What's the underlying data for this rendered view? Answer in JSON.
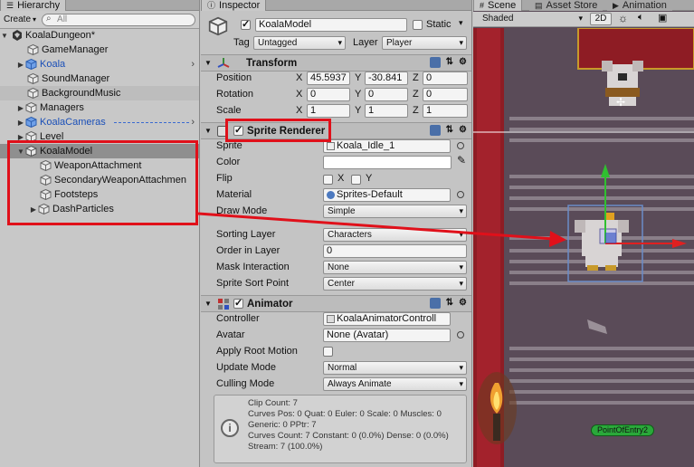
{
  "hierarchy": {
    "tab_label": "Hierarchy",
    "create_label": "Create",
    "search_placeholder": "All",
    "scene_name": "KoalaDungeon*",
    "items": [
      {
        "label": "GameManager"
      },
      {
        "label": "Koala"
      },
      {
        "label": "SoundManager"
      },
      {
        "label": "BackgroundMusic"
      },
      {
        "label": "Managers"
      },
      {
        "label": "KoalaCameras"
      },
      {
        "label": "Level"
      },
      {
        "label": "KoalaModel"
      },
      {
        "label": "WeaponAttachment"
      },
      {
        "label": "SecondaryWeaponAttachmen"
      },
      {
        "label": "Footsteps"
      },
      {
        "label": "DashParticles"
      }
    ]
  },
  "inspector": {
    "tab_label": "Inspector",
    "object_name": "KoalaModel",
    "static_label": "Static",
    "tag_label": "Tag",
    "tag_value": "Untagged",
    "layer_label": "Layer",
    "layer_value": "Player",
    "transform": {
      "title": "Transform",
      "position_label": "Position",
      "rotation_label": "Rotation",
      "scale_label": "Scale",
      "axis_x": "X",
      "axis_y": "Y",
      "axis_z": "Z",
      "position": [
        "45.5937",
        "-30.841",
        "0"
      ],
      "rotation": [
        "0",
        "0",
        "0"
      ],
      "scale": [
        "1",
        "1",
        "1"
      ]
    },
    "sprite_renderer": {
      "title": "Sprite Renderer",
      "sprite_label": "Sprite",
      "sprite_value": "Koala_Idle_1",
      "color_label": "Color",
      "flip_label": "Flip",
      "flip_x": "X",
      "flip_y": "Y",
      "material_label": "Material",
      "material_value": "Sprites-Default",
      "draw_mode_label": "Draw Mode",
      "draw_mode_value": "Simple",
      "sorting_layer_label": "Sorting Layer",
      "sorting_layer_value": "Characters",
      "order_label": "Order in Layer",
      "order_value": "0",
      "mask_label": "Mask Interaction",
      "mask_value": "None",
      "sort_point_label": "Sprite Sort Point",
      "sort_point_value": "Center"
    },
    "animator": {
      "title": "Animator",
      "controller_label": "Controller",
      "controller_value": "KoalaAnimatorControll",
      "avatar_label": "Avatar",
      "avatar_value": "None (Avatar)",
      "root_motion_label": "Apply Root Motion",
      "update_label": "Update Mode",
      "update_value": "Normal",
      "culling_label": "Culling Mode",
      "culling_value": "Always Animate",
      "info": [
        "Clip Count: 7",
        "Curves Pos: 0 Quat: 0 Euler: 0 Scale: 0 Muscles: 0",
        "Generic: 0 PPtr: 7",
        "Curves Count: 7 Constant: 0 (0.0%) Dense: 0 (0.0%)",
        "Stream: 7 (100.0%)"
      ]
    }
  },
  "scene": {
    "tabs": [
      {
        "label": "Scene"
      },
      {
        "label": "Asset Store"
      },
      {
        "label": "Animation"
      }
    ],
    "shading_value": "Shaded",
    "mode_2d": "2D",
    "point_label": "PointOfEntry2"
  },
  "colors": {
    "annotation_red": "#e0101a",
    "selection_gray": "#8f8f8f",
    "prefab_blue": "#1a4fb8",
    "scene_bg": "#5a4b58",
    "carpet_red": "#8e1c24"
  }
}
